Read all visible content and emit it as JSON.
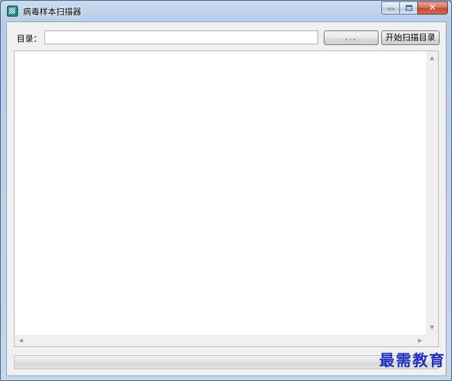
{
  "window": {
    "title": "病毒样本扫描器",
    "icon": "app-logo-icon",
    "caption": {
      "minimize": "minimize-icon",
      "maximize": "maximize-icon",
      "close": "✕"
    }
  },
  "toolbar": {
    "dir_label": "目录：",
    "path_value": "",
    "browse_label": "...",
    "scan_label": "开始扫描目录"
  },
  "results": {
    "items": []
  },
  "progress": {
    "value": 0
  },
  "watermark": "最需教育",
  "colors": {
    "accent": "#1e2fbf",
    "close_button": "#c34a34"
  }
}
